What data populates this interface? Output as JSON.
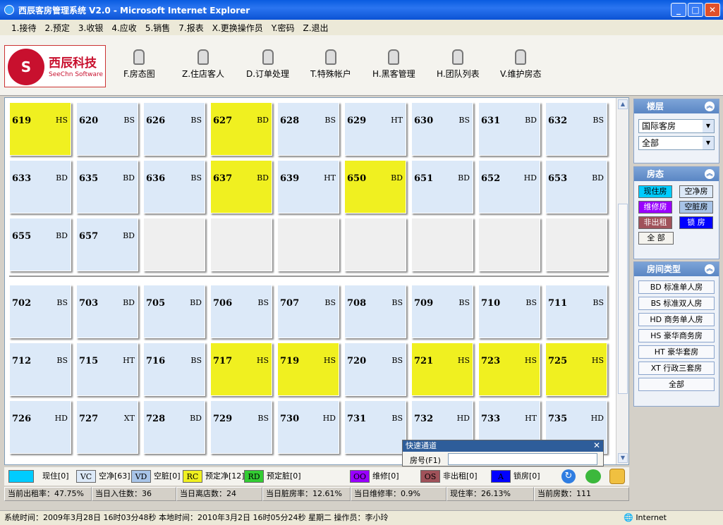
{
  "window": {
    "title": "西辰客房管理系统 V2.0 - Microsoft Internet Explorer"
  },
  "menu": [
    "1.接待",
    "2.预定",
    "3.收银",
    "4.应收",
    "5.销售",
    "7.报表",
    "X.更换操作员",
    "Y.密码",
    "Z.退出"
  ],
  "logo": {
    "cn": "西辰科技",
    "en": "SeeChn Software",
    "mark": "S"
  },
  "tools": [
    {
      "label": "F.房态图",
      "icon": "microphone-icon"
    },
    {
      "label": "Z.住店客人",
      "icon": "microphone-icon"
    },
    {
      "label": "D.订单处理",
      "icon": "microphone-icon"
    },
    {
      "label": "T.特殊帐户",
      "icon": "microphone-icon"
    },
    {
      "label": "H.黑客管理",
      "icon": "microphone-icon"
    },
    {
      "label": "H.团队列表",
      "icon": "microphone-icon"
    },
    {
      "label": "V.维护房态",
      "icon": "microphone-icon"
    }
  ],
  "rooms": [
    {
      "num": "619",
      "type": "HS",
      "status": "reserved-clean"
    },
    {
      "num": "620",
      "type": "BS",
      "status": "vacant"
    },
    {
      "num": "626",
      "type": "BS",
      "status": "vacant"
    },
    {
      "num": "627",
      "type": "BD",
      "status": "reserved-clean"
    },
    {
      "num": "628",
      "type": "BS",
      "status": "vacant"
    },
    {
      "num": "629",
      "type": "HT",
      "status": "vacant"
    },
    {
      "num": "630",
      "type": "BS",
      "status": "vacant"
    },
    {
      "num": "631",
      "type": "BD",
      "status": "vacant"
    },
    {
      "num": "632",
      "type": "BS",
      "status": "vacant"
    },
    {
      "num": "633",
      "type": "BD",
      "status": "vacant"
    },
    {
      "num": "635",
      "type": "BD",
      "status": "vacant"
    },
    {
      "num": "636",
      "type": "BS",
      "status": "vacant"
    },
    {
      "num": "637",
      "type": "BD",
      "status": "reserved-clean"
    },
    {
      "num": "639",
      "type": "HT",
      "status": "vacant"
    },
    {
      "num": "650",
      "type": "BD",
      "status": "reserved-clean"
    },
    {
      "num": "651",
      "type": "BD",
      "status": "vacant"
    },
    {
      "num": "652",
      "type": "HD",
      "status": "vacant"
    },
    {
      "num": "653",
      "type": "BD",
      "status": "vacant"
    },
    {
      "num": "655",
      "type": "BD",
      "status": "vacant"
    },
    {
      "num": "657",
      "type": "BD",
      "status": "vacant"
    },
    {
      "num": "",
      "type": "",
      "status": "empty"
    },
    {
      "num": "",
      "type": "",
      "status": "empty"
    },
    {
      "num": "",
      "type": "",
      "status": "empty"
    },
    {
      "num": "",
      "type": "",
      "status": "empty"
    },
    {
      "num": "",
      "type": "",
      "status": "empty"
    },
    {
      "num": "",
      "type": "",
      "status": "empty"
    },
    {
      "num": "",
      "type": "",
      "status": "empty"
    },
    {
      "num": "702",
      "type": "BS",
      "status": "vacant"
    },
    {
      "num": "703",
      "type": "BD",
      "status": "vacant"
    },
    {
      "num": "705",
      "type": "BD",
      "status": "vacant"
    },
    {
      "num": "706",
      "type": "BS",
      "status": "vacant"
    },
    {
      "num": "707",
      "type": "BS",
      "status": "vacant"
    },
    {
      "num": "708",
      "type": "BS",
      "status": "vacant"
    },
    {
      "num": "709",
      "type": "BS",
      "status": "vacant"
    },
    {
      "num": "710",
      "type": "BS",
      "status": "vacant"
    },
    {
      "num": "711",
      "type": "BS",
      "status": "vacant"
    },
    {
      "num": "712",
      "type": "BS",
      "status": "vacant"
    },
    {
      "num": "715",
      "type": "HT",
      "status": "vacant"
    },
    {
      "num": "716",
      "type": "BS",
      "status": "vacant"
    },
    {
      "num": "717",
      "type": "HS",
      "status": "reserved-clean"
    },
    {
      "num": "719",
      "type": "HS",
      "status": "reserved-clean"
    },
    {
      "num": "720",
      "type": "BS",
      "status": "vacant"
    },
    {
      "num": "721",
      "type": "HS",
      "status": "reserved-clean"
    },
    {
      "num": "723",
      "type": "HS",
      "status": "reserved-clean"
    },
    {
      "num": "725",
      "type": "HS",
      "status": "reserved-clean"
    },
    {
      "num": "726",
      "type": "HD",
      "status": "vacant"
    },
    {
      "num": "727",
      "type": "XT",
      "status": "vacant"
    },
    {
      "num": "728",
      "type": "BD",
      "status": "vacant"
    },
    {
      "num": "729",
      "type": "BS",
      "status": "vacant"
    },
    {
      "num": "730",
      "type": "HD",
      "status": "vacant"
    },
    {
      "num": "731",
      "type": "BS",
      "status": "vacant"
    },
    {
      "num": "732",
      "type": "HD",
      "status": "vacant"
    },
    {
      "num": "733",
      "type": "HT",
      "status": "vacant"
    },
    {
      "num": "735",
      "type": "HD",
      "status": "vacant"
    }
  ],
  "quick": {
    "title": "快速通道",
    "close": "✕",
    "label": "房号(F1)",
    "value": ""
  },
  "legend": [
    {
      "code": "",
      "label": "现住[0]",
      "color": "#00ccff"
    },
    {
      "code": "VC",
      "label": "空净[63]",
      "color": "#dce9f8"
    },
    {
      "code": "VD",
      "label": "空脏[0]",
      "color": "#a8c4e8"
    },
    {
      "code": "RC",
      "label": "预定净[12]",
      "color": "#f0f020"
    },
    {
      "code": "RD",
      "label": "预定脏[0]",
      "color": "#33cc33"
    },
    {
      "code": "OO",
      "label": "维修[0]",
      "color": "#9900ff"
    },
    {
      "code": "OS",
      "label": "非出租[0]",
      "color": "#a0525a"
    },
    {
      "code": "A",
      "label": "锁房[0]",
      "color": "#0000ff"
    }
  ],
  "stats": [
    "当前出租率：47.75%",
    "当日入住数：36",
    "当日离店数：24",
    "当日脏房率：12.61%",
    "当日维修率：0.9%",
    "现住率：26.13%",
    "当前房数：111"
  ],
  "status_bar": {
    "text": "系统时间：2009年3月28日  16时03分48秒  本地时间：2010年3月2日  16时05分24秒 星期二  操作员：李小玲",
    "zone": "Internet"
  },
  "sidebar": {
    "floor": {
      "title": "楼层",
      "building": "国际客房",
      "floor": "全部"
    },
    "state": {
      "title": "房态",
      "buttons": [
        {
          "label": "现住房",
          "color": "#00ccff"
        },
        {
          "label": "空净房",
          "color": "#dce9f8"
        },
        {
          "label": "维修房",
          "color": "#9900ff"
        },
        {
          "label": "空脏房",
          "color": "#a8c4e8"
        },
        {
          "label": "非出租",
          "color": "#a0525a"
        },
        {
          "label": "锁 房",
          "color": "#0000ff"
        },
        {
          "label": "全 部",
          "color": "#f4f3ee"
        }
      ]
    },
    "types": {
      "title": "房间类型",
      "items": [
        "BD 标准单人房",
        "BS 标准双人房",
        "HD 商务单人房",
        "HS 豪华商务房",
        "HT 豪华套房",
        "XT 行政三套房",
        "全部"
      ]
    }
  }
}
